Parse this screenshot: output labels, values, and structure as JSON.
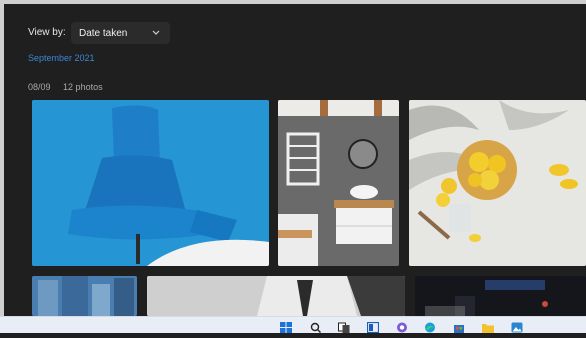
{
  "toolbar": {
    "view_by_label": "View by:",
    "view_by_value": "Date taken"
  },
  "gallery": {
    "month_heading": "September 2021",
    "group": {
      "date": "08/09",
      "count": "12 photos"
    }
  },
  "taskbar": {
    "icons": [
      "windows-start-icon",
      "search-icon",
      "task-view-icon",
      "widgets-icon",
      "teams-chat-icon",
      "edge-icon",
      "store-icon",
      "file-explorer-icon",
      "photos-icon"
    ]
  },
  "colors": {
    "background": "#1f1f1f",
    "accent_link": "#3a87d6",
    "dropdown_bg": "#2b2b2b",
    "taskbar_bg": "#e9eef6"
  }
}
